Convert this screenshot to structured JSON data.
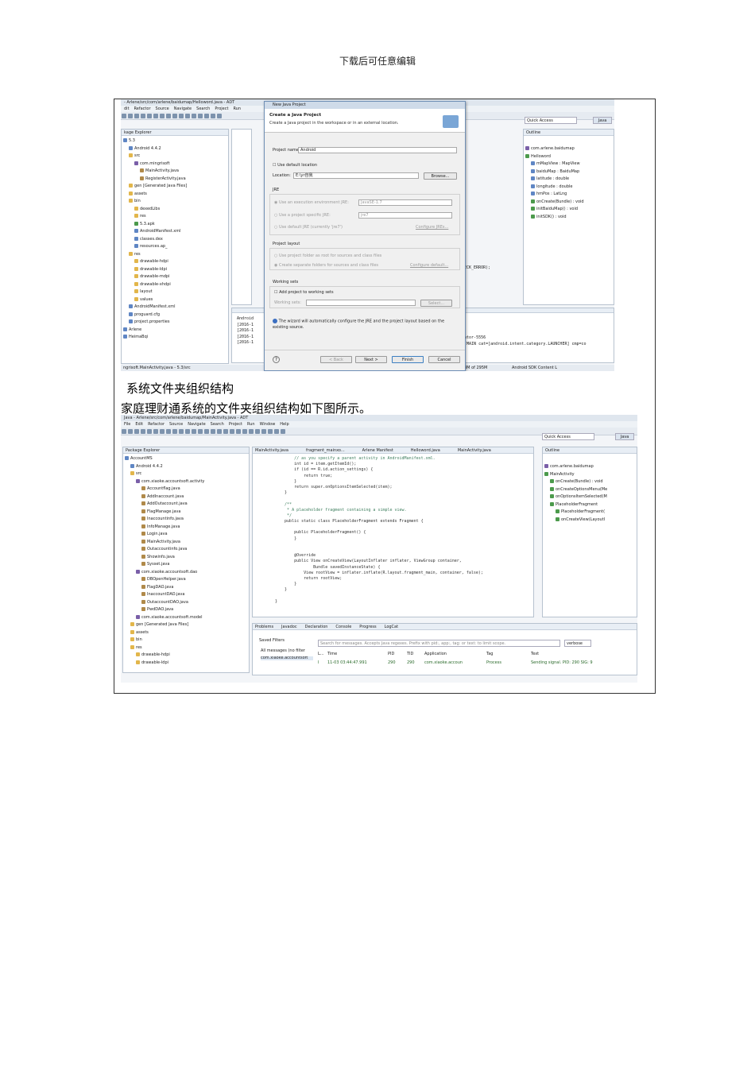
{
  "header": {
    "text": "下载后可任意编辑"
  },
  "caption_title": "系统文件夹组织结构",
  "caption_body": "家庭理财通系统的文件夹组织结构如下图所示。",
  "shot1": {
    "window_title": "- Arlene/src/com/arlene/baidumap/Helloword.java - ADT",
    "menus": [
      "dit",
      "Refactor",
      "Source",
      "Navigate",
      "Search",
      "Project",
      "Run"
    ],
    "package_explorer_title": "kage Explorer",
    "tree": [
      {
        "label": "5.3",
        "icon": "project-icon"
      },
      {
        "label": "Android 4.4.2",
        "icon": "library-icon"
      },
      {
        "label": "src",
        "icon": "folder-icon"
      },
      {
        "label": "com.mingrisoft",
        "icon": "package-icon"
      },
      {
        "label": "MainActivity.java",
        "icon": "java-file-icon"
      },
      {
        "label": "RegisterActivity.java",
        "icon": "java-file-icon"
      },
      {
        "label": "gen [Generated Java Files]",
        "icon": "folder-icon"
      },
      {
        "label": "assets",
        "icon": "folder-icon"
      },
      {
        "label": "bin",
        "icon": "folder-icon"
      },
      {
        "label": "dexedLibs",
        "icon": "folder-icon"
      },
      {
        "label": "res",
        "icon": "folder-icon"
      },
      {
        "label": "5.3.apk",
        "icon": "apk-icon"
      },
      {
        "label": "AndroidManifest.xml",
        "icon": "xml-file-icon"
      },
      {
        "label": "classes.dex",
        "icon": "file-icon"
      },
      {
        "label": "resources.ap_",
        "icon": "file-icon"
      },
      {
        "label": "res",
        "icon": "folder-icon"
      },
      {
        "label": "drawable-hdpi",
        "icon": "folder-icon"
      },
      {
        "label": "drawable-ldpi",
        "icon": "folder-icon"
      },
      {
        "label": "drawable-mdpi",
        "icon": "folder-icon"
      },
      {
        "label": "drawable-xhdpi",
        "icon": "folder-icon"
      },
      {
        "label": "layout",
        "icon": "folder-icon"
      },
      {
        "label": "values",
        "icon": "folder-icon"
      },
      {
        "label": "AndroidManifest.xml",
        "icon": "xml-file-icon"
      },
      {
        "label": "proguard.cfg",
        "icon": "file-icon"
      },
      {
        "label": "project.properties",
        "icon": "file-icon"
      },
      {
        "label": "Arlene",
        "icon": "project-icon"
      },
      {
        "label": "HeimaBqi",
        "icon": "project-icon"
      }
    ],
    "status_text": "ngrisoft.MainActivity.java - 5.3/src",
    "quick_access": "Quick Access",
    "perspective": "Java",
    "outline_title": "Outline",
    "outline": [
      {
        "label": "com.arlene.baidumap",
        "icon": "package-icon"
      },
      {
        "label": "Helloword",
        "icon": "class-icon"
      },
      {
        "label": "mMapView : MapView",
        "icon": "field-icon"
      },
      {
        "label": "baiduMap : BaiduMap",
        "icon": "field-icon"
      },
      {
        "label": "latitude : double",
        "icon": "field-icon"
      },
      {
        "label": "longitude : double",
        "icon": "field-icon"
      },
      {
        "label": "hmPos : LatLng",
        "icon": "field-icon"
      },
      {
        "label": "onCreate(Bundle) : void",
        "icon": "method-icon"
      },
      {
        "label": "initBaiduMap() : void",
        "icon": "method-icon"
      },
      {
        "label": "initSDK() : void",
        "icon": "method-icon"
      }
    ],
    "code_fragment": "ECK_ERROR);",
    "console_lines": [
      "Android",
      "[2016-1",
      "[2016-1",
      "[2016-1",
      "[2016-1"
    ],
    "console_right": [
      "ulator-5556",
      "on.MAIN cat=[android.intent.category.LAUNCHER] cmp=co"
    ],
    "memory": "3M of 295M",
    "sdk_status": "Android SDK Content L",
    "dialog": {
      "title": "New Java Project",
      "heading": "Create a Java Project",
      "subheading": "Create a Java project in the workspace or in an external location.",
      "project_name_label": "Project name:",
      "project_name_value": "Android",
      "use_default_location": "Use default location",
      "location_label": "Location:",
      "location_value": "E:\\yr自我",
      "browse": "Browse...",
      "jre_label": "JRE",
      "jre_exec_env": "Use an execution environment JRE:",
      "jre_exec_value": "JavaSE-1.7",
      "jre_specific": "Use a project specific JRE:",
      "jre_specific_value": "jre7",
      "jre_default": "Use default JRE (currently 'jre7')",
      "configure_jres": "Configure JREs...",
      "layout_label": "Project layout",
      "layout_option1": "Use project folder as root for sources and class files",
      "layout_option2": "Create separate folders for sources and class files",
      "configure_default": "Configure default...",
      "working_sets_label": "Working sets",
      "add_to_working_sets": "Add project to working sets",
      "working_sets_field": "Working sets:",
      "select": "Select...",
      "info": "The wizard will automatically configure the JRE and the project layout based on the existing source.",
      "back": "< Back",
      "next": "Next >",
      "finish": "Finish",
      "cancel": "Cancel"
    }
  },
  "shot2": {
    "window_title": "Java - Arlene/src/com/arlene/baidumap/MainActivity.java - ADT",
    "menus": [
      "File",
      "Edit",
      "Refactor",
      "Source",
      "Navigate",
      "Search",
      "Project",
      "Run",
      "Window",
      "Help"
    ],
    "quick_access": "Quick Access",
    "perspective": "Java",
    "package_explorer_title": "Package Explorer",
    "tree": [
      {
        "label": "AccountMS",
        "icon": "project-icon"
      },
      {
        "label": "Android 4.4.2",
        "icon": "library-icon"
      },
      {
        "label": "src",
        "icon": "folder-icon"
      },
      {
        "label": "com.xiaoke.accountsoft.activity",
        "icon": "package-icon"
      },
      {
        "label": "Accountflag.java",
        "icon": "java-file-icon"
      },
      {
        "label": "AddInaccount.java",
        "icon": "java-file-icon"
      },
      {
        "label": "AddOutaccount.java",
        "icon": "java-file-icon"
      },
      {
        "label": "FlagManage.java",
        "icon": "java-file-icon"
      },
      {
        "label": "Inaccountinfo.java",
        "icon": "java-file-icon"
      },
      {
        "label": "InfoManage.java",
        "icon": "java-file-icon"
      },
      {
        "label": "Login.java",
        "icon": "java-file-icon"
      },
      {
        "label": "MainActivity.java",
        "icon": "java-file-icon"
      },
      {
        "label": "Outaccountinfo.java",
        "icon": "java-file-icon"
      },
      {
        "label": "Showinfo.java",
        "icon": "java-file-icon"
      },
      {
        "label": "Sysset.java",
        "icon": "java-file-icon"
      },
      {
        "label": "com.xiaoke.accountsoft.dao",
        "icon": "package-icon"
      },
      {
        "label": "DBOpenHelper.java",
        "icon": "java-file-icon"
      },
      {
        "label": "FlagDAO.java",
        "icon": "java-file-icon"
      },
      {
        "label": "InaccountDAO.java",
        "icon": "java-file-icon"
      },
      {
        "label": "OutaccountDAO.java",
        "icon": "java-file-icon"
      },
      {
        "label": "PwdDAO.java",
        "icon": "java-file-icon"
      },
      {
        "label": "com.xiaoke.accountsoft.model",
        "icon": "package-icon"
      },
      {
        "label": "gen [Generated Java Files]",
        "icon": "folder-icon"
      },
      {
        "label": "assets",
        "icon": "folder-icon"
      },
      {
        "label": "bin",
        "icon": "folder-icon"
      },
      {
        "label": "res",
        "icon": "folder-icon"
      },
      {
        "label": "drawable-hdpi",
        "icon": "folder-icon"
      },
      {
        "label": "drawable-ldpi",
        "icon": "folder-icon"
      }
    ],
    "editor_tabs": [
      "MainActivity.java",
      "fragment_mainxo...",
      "Arlene Manifest",
      "Helloword.java",
      "MainActivity.java"
    ],
    "code": [
      "        // as you specify a parent activity in AndroidManifest.xml.",
      "        int id = item.getItemId();",
      "        if (id == R.id.action_settings) {",
      "            return true;",
      "        }",
      "        return super.onOptionsItemSelected(item);",
      "    }",
      "",
      "    /**",
      "     * A placeholder fragment containing a simple view.",
      "     */",
      "    public static class PlaceholderFragment extends Fragment {",
      "",
      "        public PlaceholderFragment() {",
      "        }",
      "",
      "",
      "        @Override",
      "        public View onCreateView(LayoutInflater inflater, ViewGroup container,",
      "                Bundle savedInstanceState) {",
      "            View rootView = inflater.inflate(R.layout.fragment_main, container, false);",
      "            return rootView;",
      "        }",
      "    }",
      "",
      "}"
    ],
    "outline_title": "Outline",
    "outline": [
      {
        "label": "com.arlene.baidumap",
        "icon": "package-icon"
      },
      {
        "label": "MainActivity",
        "icon": "class-icon"
      },
      {
        "label": "onCreate(Bundle) : void",
        "icon": "method-icon"
      },
      {
        "label": "onCreateOptionsMenu(Me",
        "icon": "method-icon"
      },
      {
        "label": "onOptionsItemSelected(M",
        "icon": "method-icon"
      },
      {
        "label": "PlaceholderFragment",
        "icon": "class-icon"
      },
      {
        "label": "PlaceholderFragment(",
        "icon": "method-icon"
      },
      {
        "label": "onCreateView(LayoutI",
        "icon": "method-icon"
      }
    ],
    "bottom_tabs": [
      "Problems",
      "Javadoc",
      "Declaration",
      "Console",
      "Progress",
      "LogCat"
    ],
    "saved_filters": "Saved Filters",
    "all_messages": "All messages (no filter",
    "filter_item": "com.xiaoke.accountsoft",
    "search_placeholder": "Search for messages. Accepts Java regexes. Prefix with pid:, app:, tag: or text: to limit scope.",
    "verbose": "verbose",
    "log_columns": [
      "L...",
      "Time",
      "PID",
      "TID",
      "Application",
      "Tag",
      "Text"
    ],
    "log_row": [
      "I",
      "11-03 03:44:47.991",
      "290",
      "290",
      "com.xiaoke.accoun",
      "Process",
      "Sending signal. PID: 290 SIG: 9"
    ]
  }
}
